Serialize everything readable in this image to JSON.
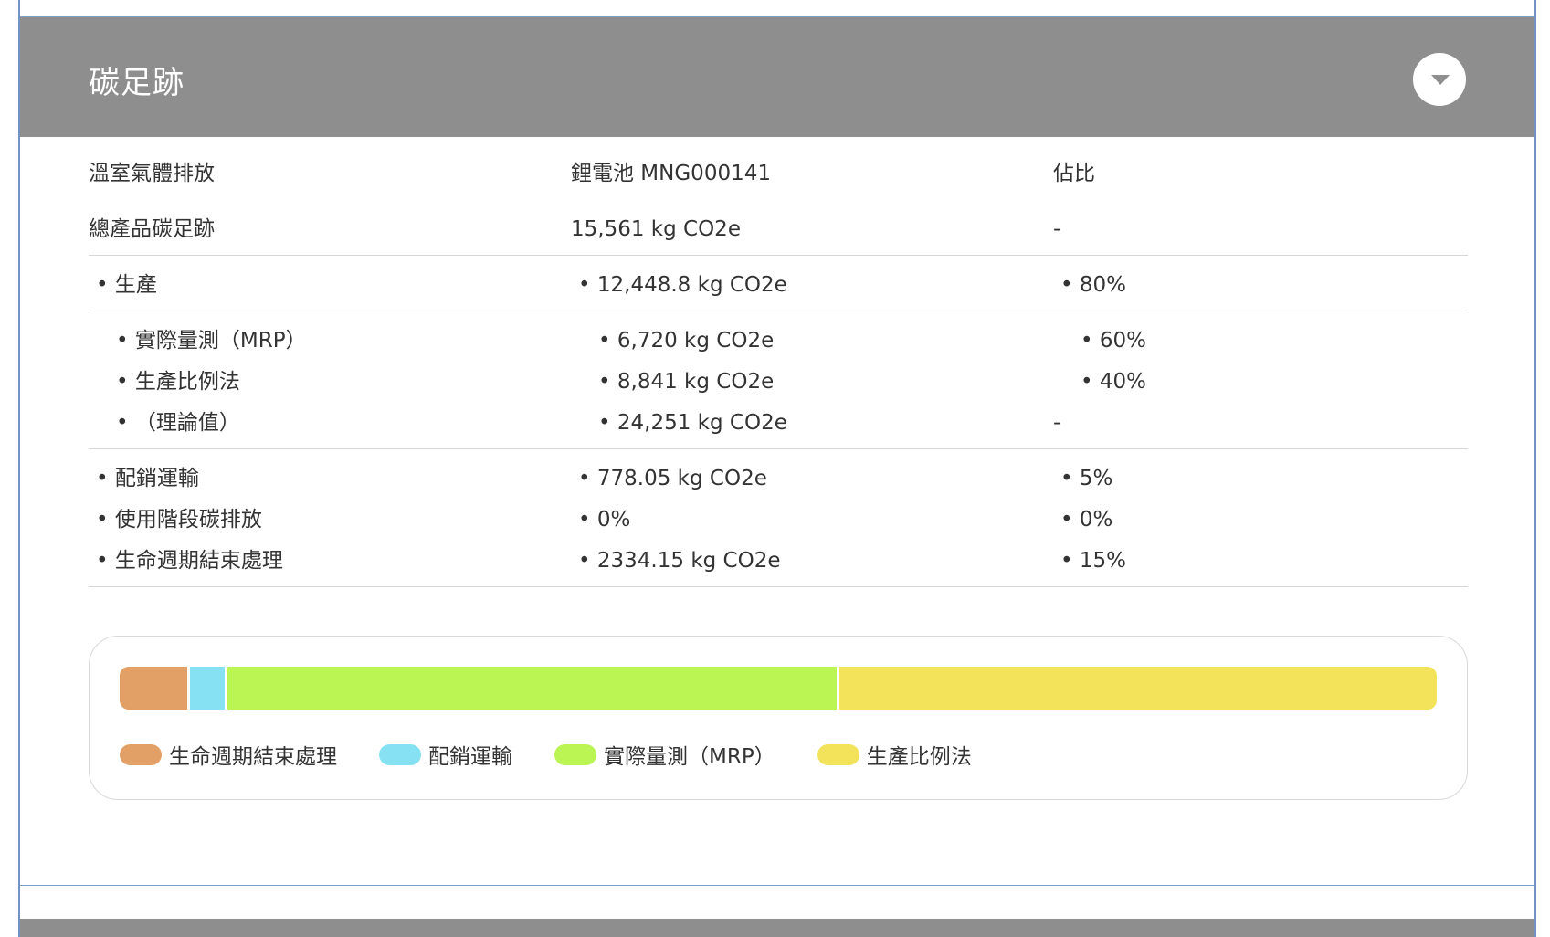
{
  "panel": {
    "title": "碳足跡",
    "toggle_icon": "chevron-down-icon"
  },
  "table": {
    "header": {
      "col1": "溫室氣體排放",
      "col2": "鋰電池 MNG000141",
      "col3": "佔比"
    },
    "total": {
      "label": "總產品碳足跡",
      "value": "15,561 kg CO2e",
      "share": "-"
    },
    "production": {
      "label": "生產",
      "value": "12,448.8 kg CO2e",
      "share": "80%"
    },
    "production_sub": [
      {
        "label": "實際量測（MRP）",
        "value": "6,720 kg CO2e",
        "share": "60%"
      },
      {
        "label": "生產比例法",
        "value": "8,841 kg CO2e",
        "share": "40%"
      },
      {
        "label": "（理論值）",
        "value": "24,251 kg CO2e",
        "share": "-"
      }
    ],
    "others": [
      {
        "label": "配銷運輸",
        "value": "778.05 kg CO2e",
        "share": "5%"
      },
      {
        "label": "使用階段碳排放",
        "value": "0%",
        "share": "0%"
      },
      {
        "label": "生命週期結束處理",
        "value": "2334.15 kg CO2e",
        "share": "15%"
      }
    ]
  },
  "chart_data": {
    "type": "bar",
    "stacked": true,
    "series": [
      {
        "name": "生命週期結束處理",
        "value": 5.1,
        "color": "#e2a067"
      },
      {
        "name": "配銷運輸",
        "value": 2.7,
        "color": "#86e2f2"
      },
      {
        "name": "實際量測（MRP）",
        "value": 46.2,
        "color": "#baf553"
      },
      {
        "name": "生產比例法",
        "value": 46.0,
        "color": "#f2e35a"
      }
    ],
    "legend_position": "bottom-left"
  }
}
